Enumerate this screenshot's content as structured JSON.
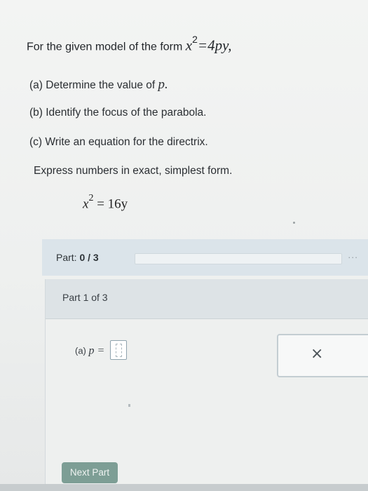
{
  "question": {
    "intro_text": "For the given model of the form ",
    "intro_model": "x",
    "intro_exp": "2",
    "intro_rhs": "=4py,",
    "part_a_text": "(a) Determine the value of ",
    "part_a_var": "p.",
    "part_b": "(b) Identify the focus of the parabola.",
    "part_c": "(c) Write an equation for the directrix.",
    "instructions": "Express numbers in exact, simplest form.",
    "equation_lhs": "x",
    "equation_exp": "2",
    "equation_rhs": "= 16y"
  },
  "progress": {
    "label": "Part:",
    "value": "0 / 3",
    "fraction": 0,
    "menu": "..."
  },
  "panel": {
    "title": "Part 1 of 3",
    "answer_label": "(a)",
    "answer_var": "p =",
    "answer_value": ""
  },
  "sidebox": {
    "close_icon": "close-icon",
    "close_glyph": "×"
  },
  "nav": {
    "next_label": "Next Part"
  },
  "colors": {
    "accent": "#7d9e95",
    "header": "#dbe4ea"
  }
}
